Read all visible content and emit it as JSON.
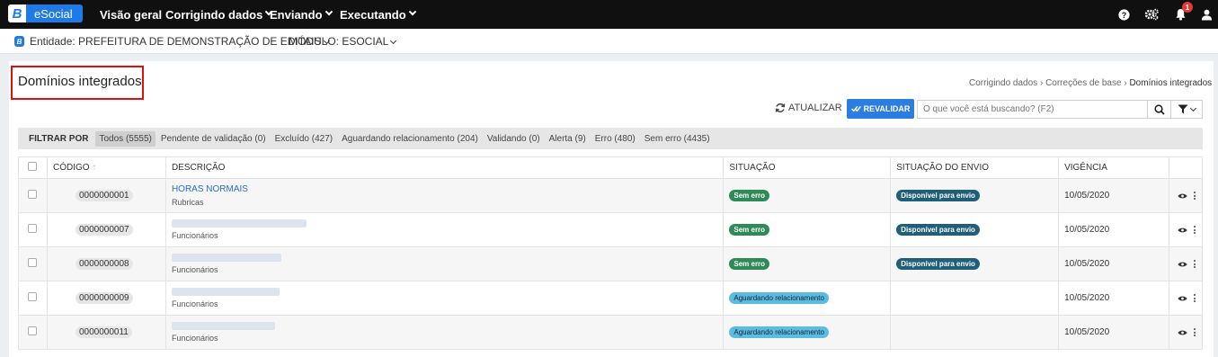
{
  "app": {
    "logo_letter": "B",
    "logo_name": "eSocial",
    "accent": "#1e7ae6"
  },
  "nav": [
    {
      "label": "Visão geral"
    },
    {
      "label": "Corrigindo dados"
    },
    {
      "label": "Enviando"
    },
    {
      "label": "Executando"
    }
  ],
  "topbar_icons": {
    "help": "help-icon",
    "settings": "gears-icon",
    "notifications": "bell-icon",
    "notifications_count": "1",
    "user": "user-icon"
  },
  "entity": {
    "label": "Entidade: PREFEITURA DE DEMONSTRAÇÃO DE EDITAIS",
    "module": "MÓDULO: ESOCIAL"
  },
  "page": {
    "title": "Domínios integrados",
    "breadcrumb": [
      "Corrigindo dados",
      "Correções de base",
      "Domínios integrados"
    ]
  },
  "toolbar": {
    "refresh_label": "ATUALIZAR",
    "revalidate_label": "REVALIDAR",
    "search_placeholder": "O que você está buscando? (F2)"
  },
  "filter": {
    "label": "FILTRAR POR",
    "chips": [
      {
        "label": "Todos (5555)",
        "active": true
      },
      {
        "label": "Pendente de validação (0)"
      },
      {
        "label": "Excluído (427)"
      },
      {
        "label": "Aguardando relacionamento (204)"
      },
      {
        "label": "Validando (0)"
      },
      {
        "label": "Alerta (9)"
      },
      {
        "label": "Erro (480)"
      },
      {
        "label": "Sem erro (4435)"
      }
    ]
  },
  "table": {
    "columns": {
      "code": "CÓDIGO",
      "description": "DESCRIÇÃO",
      "status": "SITUAÇÃO",
      "send_status": "SITUAÇÃO DO ENVIO",
      "validity": "VIGÊNCIA"
    },
    "rows": [
      {
        "code": "0000000001",
        "description": "HORAS NORMAIS",
        "type": "Rubricas",
        "status": "Sem erro",
        "send_status": "Disponível para envio",
        "validity": "10/05/2020"
      },
      {
        "code": "0000000007",
        "description": "",
        "type": "Funcionários",
        "status": "Sem erro",
        "send_status": "Disponível para envio",
        "validity": "10/05/2020"
      },
      {
        "code": "0000000008",
        "description": "",
        "type": "Funcionários",
        "status": "Sem erro",
        "send_status": "Disponível para envio",
        "validity": "10/05/2020"
      },
      {
        "code": "0000000009",
        "description": "",
        "type": "Funcionários",
        "status": "Aguardando relacionamento",
        "send_status": "",
        "validity": "10/05/2020"
      },
      {
        "code": "0000000011",
        "description": "",
        "type": "Funcionários",
        "status": "Aguardando relacionamento",
        "send_status": "",
        "validity": "10/05/2020"
      }
    ]
  }
}
